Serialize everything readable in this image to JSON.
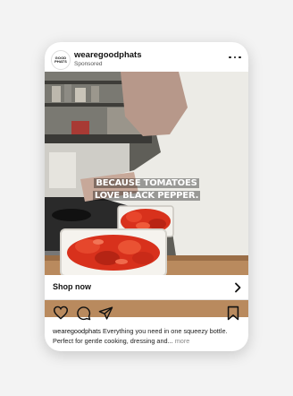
{
  "post": {
    "account_name": "wearegoodphats",
    "avatar_text": [
      "GOOD",
      "PHATS"
    ],
    "label": "Sponsored",
    "overlay_line1": "BECAUSE TOMATOES",
    "overlay_line2": "LOVE BLACK PEPPER.",
    "cta_label": "Shop now",
    "caption_user": "wearegoodphats",
    "caption_text": "Everything you need in one squeezy bottle. Perfect for gentle cooking, dressing and...",
    "caption_more": "more"
  },
  "icons": {
    "options": "more-options-icon",
    "cta_arrow": "chevron-right-icon",
    "like": "heart-icon",
    "comment": "comment-icon",
    "share": "send-icon",
    "save": "bookmark-icon"
  },
  "colors": {
    "card_background": "#ffffff",
    "text": "#111111",
    "tomato": "#d8311c"
  }
}
